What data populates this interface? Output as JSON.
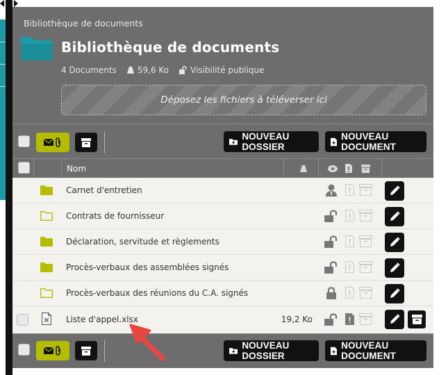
{
  "breadcrumb": "Bibliothèque de documents",
  "title": "Bibliothèque de documents",
  "meta": {
    "documents": "4 Documents",
    "size": "59,6 Ko",
    "visibility": "Visibilité publique"
  },
  "dropzone": "Déposez les fichiers à téléverser ici",
  "toolbar": {
    "new_folder": "NOUVEAU DOSSIER",
    "new_document": "NOUVEAU DOCUMENT"
  },
  "table": {
    "header_name": "Nom",
    "rows": [
      {
        "name": "Carnet d'entretien",
        "type": "folder-filled",
        "visibility": "user-icon",
        "size": ""
      },
      {
        "name": "Contrats de fournisseur",
        "type": "folder-outline",
        "visibility": "unlock-icon",
        "size": ""
      },
      {
        "name": "Déclaration, servitude et règlements",
        "type": "folder-filled",
        "visibility": "unlock-icon",
        "size": ""
      },
      {
        "name": "Procès-verbaux des assemblées signés",
        "type": "folder-filled",
        "visibility": "unlock-icon",
        "size": ""
      },
      {
        "name": "Procès-verbaux des réunions du C.A. signés",
        "type": "folder-outline",
        "visibility": "lock-icon",
        "size": ""
      },
      {
        "name": "Liste d'appel.xlsx",
        "type": "file-excel",
        "visibility": "unlock-icon",
        "size": "19,2 Ko"
      }
    ]
  },
  "colors": {
    "panel": "#6d6d6d",
    "accent": "#b5bd00",
    "folder_teal": "#1d9aa5",
    "folder_olive": "#b5bd00",
    "arrow": "#e8473f"
  }
}
